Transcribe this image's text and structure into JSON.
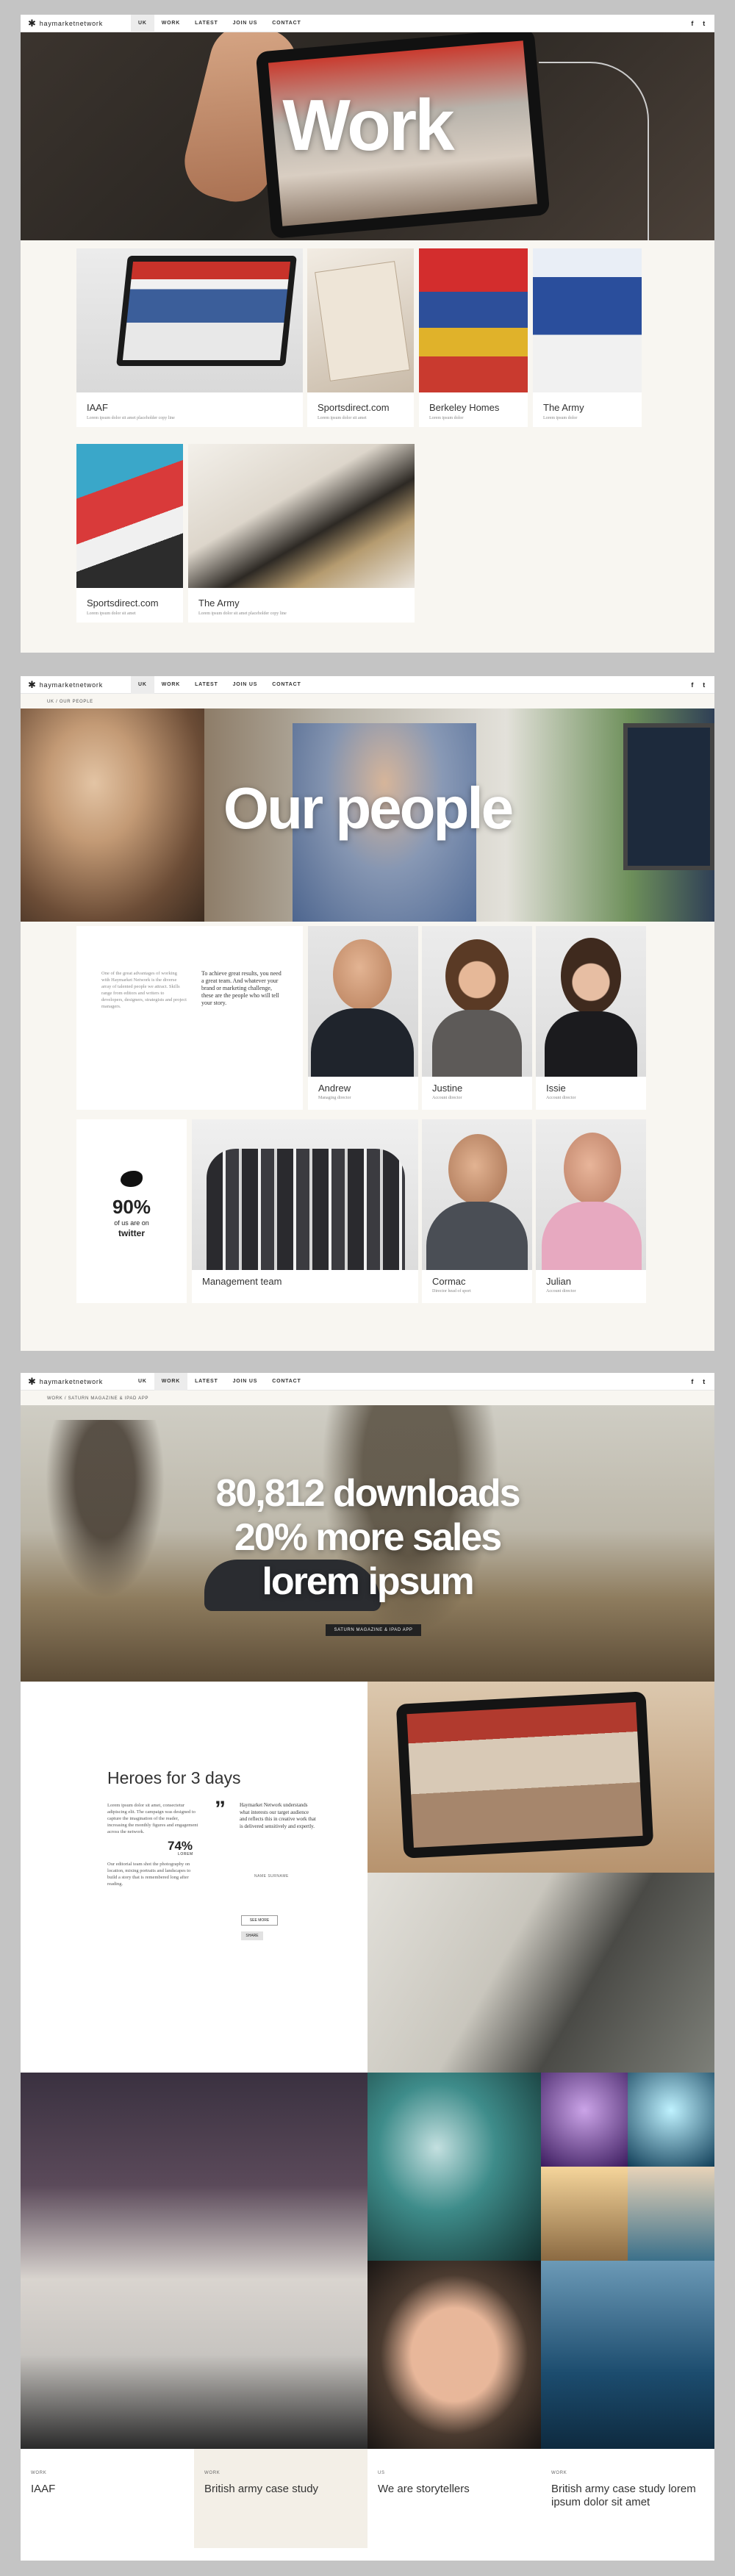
{
  "nav": {
    "logo": "haymarketnetwork",
    "items": [
      "UK",
      "WORK",
      "LATEST",
      "JOIN US",
      "CONTACT"
    ],
    "social": [
      "f",
      "t"
    ]
  },
  "work_page": {
    "hero_title": "Work",
    "cards": [
      {
        "title": "IAAF",
        "desc": "Lorem ipsum dolor sit amet placeholder copy line"
      },
      {
        "title": "Sportsdirect.com",
        "desc": "Lorem ipsum dolor sit amet"
      },
      {
        "title": "Berkeley Homes",
        "desc": "Lorem ipsum dolor"
      },
      {
        "title": "The Army",
        "desc": "Lorem ipsum dolor"
      },
      {
        "title": "Sportsdirect.com",
        "desc": "Lorem ipsum dolor sit amet"
      },
      {
        "title": "The Army",
        "desc": "Lorem ipsum dolor sit amet placeholder copy line"
      }
    ]
  },
  "people_page": {
    "breadcrumb": "UK  /  OUR PEOPLE",
    "hero_title": "Our people",
    "intro_left": "One of the great advantages of working with Haymarket Network is the diverse array of talented people we attract. Skills range from editors and writers to developers, designers, strategists and project managers.",
    "intro_right": "To achieve great results, you need a great team. And whatever your brand or marketing challenge, these are the people who will tell your story.",
    "people": [
      {
        "name": "Andrew",
        "role": "Managing director"
      },
      {
        "name": "Justine",
        "role": "Account director"
      },
      {
        "name": "Issie",
        "role": "Account director"
      },
      {
        "name": "Cormac",
        "role": "Director head of sport"
      },
      {
        "name": "Julian",
        "role": "Account director"
      }
    ],
    "twitter": {
      "stat": "90%",
      "line1": "of us are on",
      "line2": "twitter"
    },
    "team": {
      "title": "Management team"
    }
  },
  "case_page": {
    "breadcrumb": "WORK  /  SATURN MAGAZINE & IPAD APP",
    "hero_lines": [
      "80,812 downloads",
      "20% more sales",
      "lorem ipsum"
    ],
    "hero_button": "SATURN MAGAZINE & IPAD APP",
    "heading": "Heroes for 3 days",
    "body1": "Lorem ipsum dolor sit amet, consectetur adipiscing elit. The campaign was designed to capture the imagination of the reader, increasing the monthly figures and engagement across the network.",
    "body2": "Our editorial team shot the photography on location, mixing portraits and landscapes to build a story that is remembered long after reading.",
    "stat_number": "74%",
    "stat_label": "LOREM",
    "quote": "Haymarket Network understands what interests our target audience and reflects this in creative work that is delivered sensitively and expertly.",
    "quote_author": "NAME SURNAME",
    "button1": "SEE MORE",
    "button2": "SHARE",
    "footer": [
      {
        "label": "WORK",
        "title": "IAAF"
      },
      {
        "label": "WORK",
        "title": "British army case study"
      },
      {
        "label": "US",
        "title": "We are storytellers"
      },
      {
        "label": "WORK",
        "title": "British army case study lorem ipsum dolor sit amet"
      }
    ]
  }
}
